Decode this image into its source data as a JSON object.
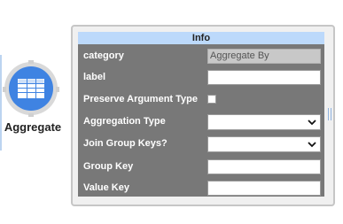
{
  "node": {
    "label": "Aggregate",
    "icon": "table-icon",
    "color": "#3f83e2"
  },
  "panel": {
    "title": "Info",
    "header_color": "#bcd9fb",
    "rows": [
      {
        "label": "category",
        "type": "readonly",
        "value": "Aggregate By"
      },
      {
        "label": "label",
        "type": "text",
        "value": ""
      },
      {
        "label": "Preserve Argument Type",
        "type": "checkbox",
        "checked": false
      },
      {
        "label": "Aggregation Type",
        "type": "select",
        "value": ""
      },
      {
        "label": "Join Group Keys?",
        "type": "select",
        "value": ""
      },
      {
        "label": "Group Key",
        "type": "text",
        "value": ""
      },
      {
        "label": "Value Key",
        "type": "text",
        "value": ""
      }
    ]
  }
}
